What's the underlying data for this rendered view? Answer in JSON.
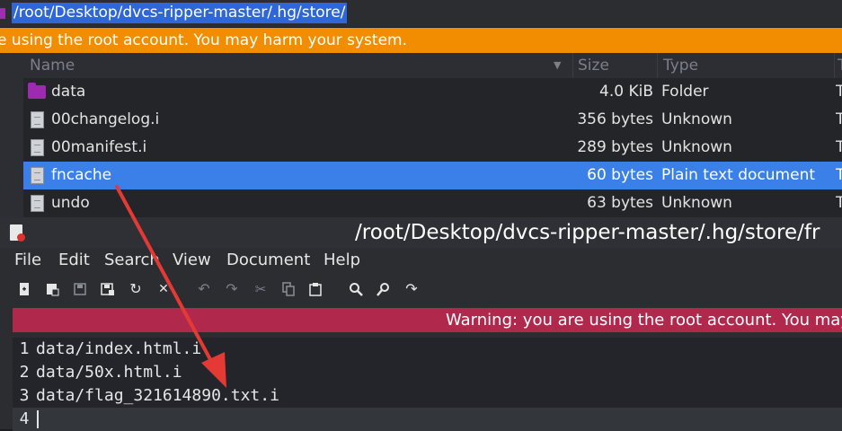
{
  "file_manager": {
    "path": "/root/Desktop/dvcs-ripper-master/.hg/store/",
    "warning": "e using the root account. You may harm your system.",
    "columns": {
      "name": "Name",
      "size": "Size",
      "type": "Type",
      "extra": "T"
    },
    "rows": [
      {
        "name": "data",
        "size": "4.0 KiB",
        "type": "Folder",
        "icon": "folder-icon",
        "extra": "T"
      },
      {
        "name": "00changelog.i",
        "size": "356 bytes",
        "type": "Unknown",
        "icon": "file-icon",
        "extra": "T"
      },
      {
        "name": "00manifest.i",
        "size": "289 bytes",
        "type": "Unknown",
        "icon": "file-icon",
        "extra": "T"
      },
      {
        "name": "fncache",
        "size": "60 bytes",
        "type": "Plain text document",
        "icon": "text-file-icon",
        "extra": "T",
        "selected": true
      },
      {
        "name": "undo",
        "size": "63 bytes",
        "type": "Unknown",
        "icon": "file-icon",
        "extra": "T"
      }
    ],
    "colors": {
      "selection": "#3a80e8",
      "warning": "#f28c00",
      "folder": "#9d2ab0"
    }
  },
  "editor": {
    "title": "/root/Desktop/dvcs-ripper-master/.hg/store/fr",
    "menu": [
      "File",
      "Edit",
      "Search",
      "View",
      "Document",
      "Help"
    ],
    "toolbar_icons": [
      "new-document-icon",
      "new-window-icon",
      "save-icon",
      "save-as-icon",
      "reload-icon",
      "close-icon",
      "undo-icon",
      "redo-icon",
      "cut-icon",
      "copy-icon",
      "paste-icon",
      "find-icon",
      "find-replace-icon",
      "go-to-line-icon"
    ],
    "warning": "Warning: you are using the root account. You may h",
    "lines": [
      {
        "num": "1",
        "text": "data/index.html.i"
      },
      {
        "num": "2",
        "text": "data/50x.html.i"
      },
      {
        "num": "3",
        "text": "data/flag_321614890.txt.i"
      },
      {
        "num": "4",
        "text": ""
      }
    ],
    "colors": {
      "warning": "#b0294c"
    }
  },
  "annotation": {
    "arrow_color": "#e53935"
  }
}
